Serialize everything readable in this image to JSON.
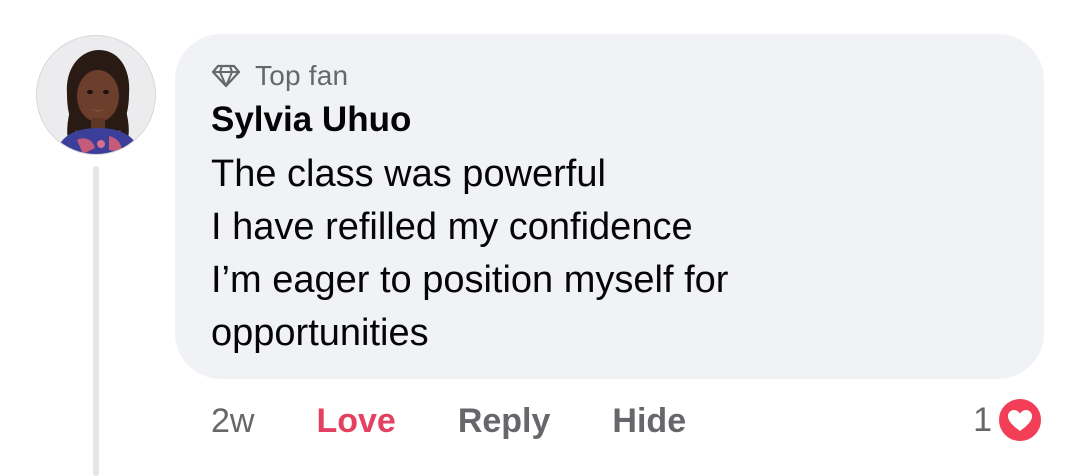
{
  "comment": {
    "avatar_icon": "user-avatar-photo",
    "badge": {
      "icon": "diamond-icon",
      "label": "Top fan"
    },
    "author": "Sylvia Uhuo",
    "lines": [
      "The class was powerful",
      "I have refilled my confidence",
      "I’m eager to position myself for",
      "opportunities"
    ]
  },
  "actions": {
    "timestamp": "2w",
    "love_label": "Love",
    "reply_label": "Reply",
    "hide_label": "Hide"
  },
  "reactions": {
    "count": "1",
    "icon": "heart-reaction-icon"
  },
  "colors": {
    "bubble_bg": "#f0f2f5",
    "love_accent": "#e4405f",
    "secondary_text": "#65676b",
    "thread_line": "#e4e6eb"
  }
}
